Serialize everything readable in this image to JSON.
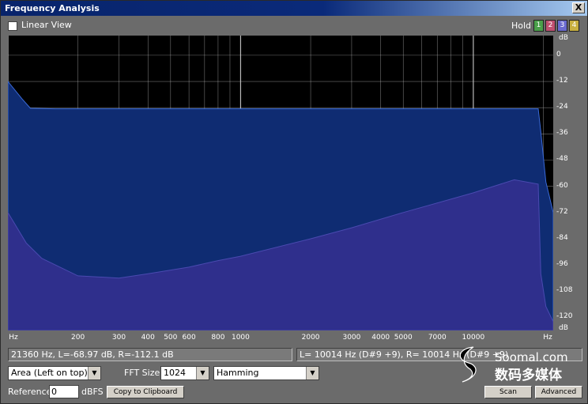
{
  "window": {
    "title": "Frequency Analysis",
    "close_label": "X"
  },
  "toolbar": {
    "linear_view_label": "Linear View",
    "linear_view_checked": false,
    "hold_label": "Hold",
    "hold_buttons": [
      {
        "label": "1",
        "color": "#4aa04a"
      },
      {
        "label": "2",
        "color": "#c05070"
      },
      {
        "label": "3",
        "color": "#6a6ad0"
      },
      {
        "label": "4",
        "color": "#c8b040"
      }
    ]
  },
  "plot": {
    "background": "#000000",
    "grid_color": "#cfcfcf",
    "fill_top_color": "#0f2c72",
    "fill_bottom_color": "#2f2f8c",
    "y_unit": "dB",
    "y_ticks": [
      "dB",
      "0",
      "-12",
      "-24",
      "-36",
      "-48",
      "-60",
      "-72",
      "-84",
      "-96",
      "-108",
      "-120",
      "dB"
    ],
    "x_ticks": [
      "Hz",
      "200",
      "300",
      "400",
      "500",
      "600",
      "800",
      "1000",
      "2000",
      "3000",
      "4000",
      "5000",
      "7000",
      "10000",
      "Hz"
    ]
  },
  "chart_data": {
    "type": "area",
    "x_scale": "log",
    "xlim": [
      100,
      22050
    ],
    "ylim": [
      -126,
      9
    ],
    "xlabel": "Hz",
    "ylabel": "dB",
    "series": [
      {
        "x": [
          100,
          115,
          125,
          160,
          200,
          300,
          500,
          1000,
          2000,
          5000,
          10000,
          18000,
          19000,
          19500,
          20500,
          22050
        ],
        "y": [
          -12,
          -20,
          -24.3,
          -24.5,
          -24.5,
          -24.5,
          -24.5,
          -24.5,
          -24.5,
          -24.5,
          -24.5,
          -24.5,
          -24.5,
          -35,
          -58,
          -72
        ]
      },
      {
        "x": [
          100,
          120,
          140,
          200,
          300,
          400,
          600,
          800,
          1000,
          2000,
          3000,
          5000,
          10000,
          15000,
          19000,
          19500,
          20500,
          22050
        ],
        "y": [
          -72,
          -86,
          -93,
          -101,
          -102,
          -100,
          -97,
          -94,
          -92,
          -84,
          -79,
          -72,
          -63,
          -57,
          -59,
          -100,
          -115,
          -122
        ]
      }
    ]
  },
  "status": {
    "cursor_readout": "21360 Hz, L=-68.97 dB, R=-112.1 dB",
    "note_readout": "L=  10014 Hz (D#9 +9), R=  10014 Hz (D#9 +9)"
  },
  "controls": {
    "display_mode": "Area (Left on top)",
    "fft_size_label": "FFT Size",
    "fft_size": "1024",
    "window_function": "Hamming",
    "reference_label": "Reference",
    "reference_value": "0",
    "reference_unit": "dBFS",
    "copy_label": "Copy to Clipboard",
    "scan_label": "Scan",
    "advanced_label": "Advanced"
  },
  "watermark": {
    "site": "Soomal.com",
    "chinese": "数码多媒体"
  }
}
